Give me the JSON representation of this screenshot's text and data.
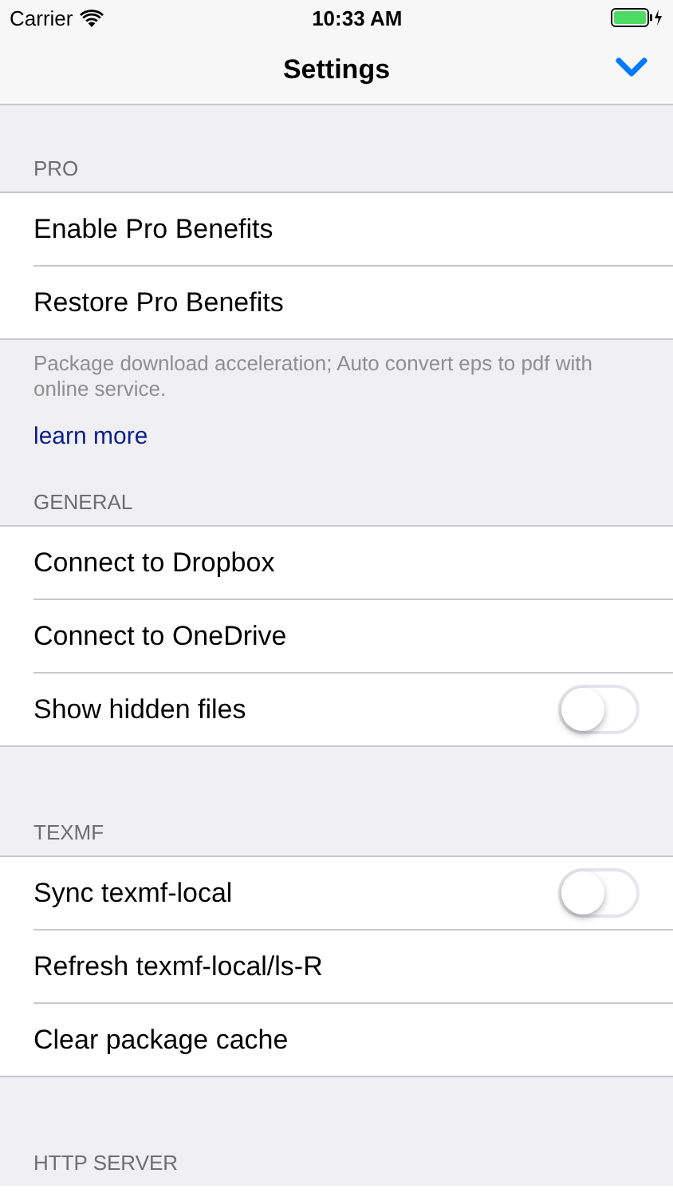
{
  "status_bar": {
    "carrier": "Carrier",
    "time": "10:33 AM"
  },
  "nav_bar": {
    "title": "Settings"
  },
  "sections": [
    {
      "header": "PRO",
      "rows": [
        {
          "kind": "action",
          "label": "Enable Pro Benefits"
        },
        {
          "kind": "action",
          "label": "Restore Pro Benefits"
        }
      ],
      "footer": {
        "text": "Package download acceleration; Auto convert eps to pdf with online service.",
        "link": "learn more"
      }
    },
    {
      "header": "GENERAL",
      "rows": [
        {
          "kind": "action",
          "label": "Connect to Dropbox"
        },
        {
          "kind": "action",
          "label": "Connect to OneDrive"
        },
        {
          "kind": "toggle",
          "label": "Show hidden files",
          "on": false
        }
      ]
    },
    {
      "header": "TEXMF",
      "rows": [
        {
          "kind": "toggle",
          "label": "Sync texmf-local",
          "on": false
        },
        {
          "kind": "action",
          "label": "Refresh texmf-local/ls-R"
        },
        {
          "kind": "action",
          "label": "Clear package cache"
        }
      ]
    },
    {
      "header": "HTTP SERVER"
    }
  ]
}
